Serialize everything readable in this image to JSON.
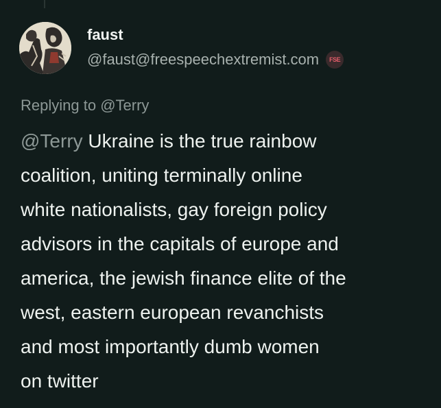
{
  "post": {
    "author": {
      "display_name": "faust",
      "handle": "@faust@freespeechextremist.com",
      "instance_badge": "FSE",
      "avatar_icon": "woodcut-portrait-avatar"
    },
    "reply_context": {
      "prefix": "Replying to ",
      "target": "@Terry"
    },
    "content": {
      "mention": "@Terry",
      "lines": [
        " Ukraine is the true rainbow",
        "coalition, uniting terminally online",
        "white nationalists, gay foreign policy",
        "advisors in the capitals of europe and",
        "america, the jewish finance elite of the",
        "west, eastern european revanchists",
        "and most importantly dumb women",
        "on twitter"
      ]
    }
  },
  "colors": {
    "background": "#111c1b",
    "text": "#eef2ef",
    "muted": "#8d9896",
    "badge_text": "#e35d6a"
  }
}
